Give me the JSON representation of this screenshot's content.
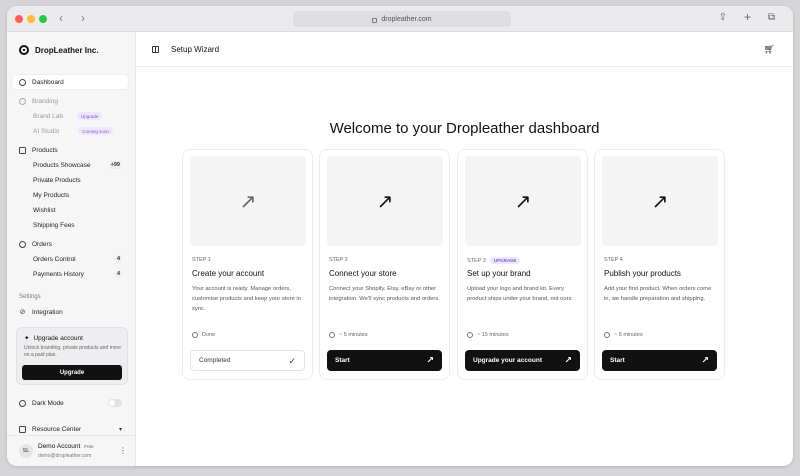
{
  "browser": {
    "url": "dropleather.com"
  },
  "sidebar": {
    "brand": "DropLeather Inc.",
    "items": [
      {
        "label": "Dashboard"
      },
      {
        "label": "Branding"
      },
      {
        "label": "Brand Lab",
        "badge": "Upgrade"
      },
      {
        "label": "AI Studio",
        "badge": "Coming soon"
      },
      {
        "label": "Products"
      },
      {
        "label": "Products Showcase",
        "count": "+99"
      },
      {
        "label": "Private Products"
      },
      {
        "label": "My Products"
      },
      {
        "label": "Wishlist"
      },
      {
        "label": "Shipping Fees"
      },
      {
        "label": "Orders"
      },
      {
        "label": "Orders Control",
        "count": "4"
      },
      {
        "label": "Payments History",
        "count": "4"
      }
    ],
    "settings_label": "Settings",
    "integration": "Integration",
    "upgrade": {
      "title": "Upgrade account",
      "desc": "Unlock branding, private products and more on a paid plan.",
      "button": "Upgrade"
    },
    "dark_mode": "Dark Mode",
    "resource_center": "Resource Center",
    "account": {
      "initials": "SL",
      "name": "Demo Account",
      "plan": "Free",
      "email": "demo@dropleather.com"
    }
  },
  "topbar": {
    "title": "Setup Wizard"
  },
  "main": {
    "headline": "Welcome to your Dropleather dashboard",
    "cards": [
      {
        "step": "STEP 1",
        "title": "Create your account",
        "desc": "Your account is ready. Manage orders, customise products and keep your store in sync.",
        "meta": "Done",
        "button": "Completed"
      },
      {
        "step": "STEP 2",
        "title": "Connect your store",
        "desc": "Connect your Shopify, Etsy, eBay or other integration. We'll sync products and orders.",
        "meta": "~ 5 minutes",
        "button": "Start"
      },
      {
        "step": "STEP 3",
        "badge": "UPGRADE",
        "title": "Set up your brand",
        "desc": "Upload your logo and brand kit. Every product ships under your brand, not ours.",
        "meta": "~ 15 minutes",
        "button": "Upgrade your account"
      },
      {
        "step": "STEP 4",
        "title": "Publish your products",
        "desc": "Add your first product. When orders come in, we handle preparation and shipping.",
        "meta": "~ 5 minutes",
        "button": "Start"
      }
    ]
  }
}
